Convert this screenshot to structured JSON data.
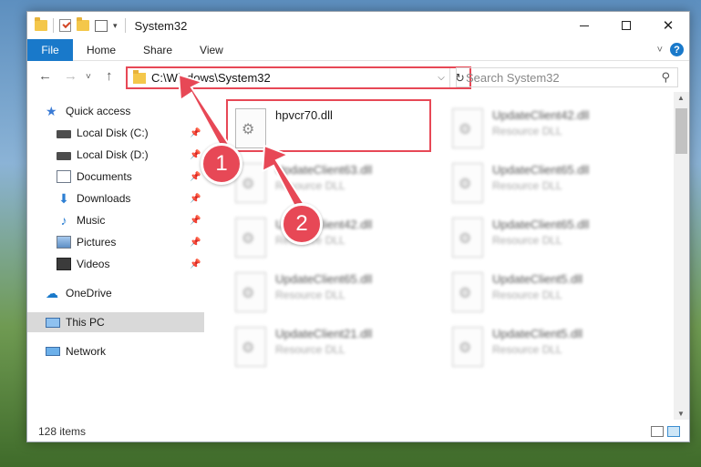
{
  "window": {
    "title": "System32",
    "buttons": {
      "minimize": "—",
      "maximize": "□",
      "close": "✕"
    }
  },
  "ribbon": {
    "file_tab": "File",
    "tabs": [
      "Home",
      "Share",
      "View"
    ]
  },
  "navbar": {
    "back": "←",
    "forward": "→",
    "recent": "˅",
    "up": "↑",
    "address": "C:\\Windows\\System32",
    "search_placeholder": "Search System32"
  },
  "sidebar": {
    "items": [
      {
        "label": "Quick access",
        "icon": "star-icon"
      },
      {
        "label": "Local Disk (C:)",
        "icon": "drive-icon",
        "pinned": true
      },
      {
        "label": "Local Disk (D:)",
        "icon": "drive-icon",
        "pinned": true
      },
      {
        "label": "Documents",
        "icon": "documents-icon",
        "pinned": true
      },
      {
        "label": "Downloads",
        "icon": "downloads-icon",
        "pinned": true
      },
      {
        "label": "Music",
        "icon": "music-icon",
        "pinned": true
      },
      {
        "label": "Pictures",
        "icon": "pictures-icon",
        "pinned": true
      },
      {
        "label": "Videos",
        "icon": "videos-icon",
        "pinned": true
      },
      {
        "label": "OneDrive",
        "icon": "onedrive-icon"
      },
      {
        "label": "This PC",
        "icon": "this-pc-icon",
        "selected": true
      },
      {
        "label": "Network",
        "icon": "network-icon"
      }
    ]
  },
  "files": [
    {
      "name": "hpvcr70.dll",
      "type": "",
      "highlighted": true
    },
    {
      "name": "UpdateClient42.dll",
      "type": "Resource DLL"
    },
    {
      "name": "UpdateClient63.dll",
      "type": "Resource DLL"
    },
    {
      "name": "UpdateClient65.dll",
      "type": "Resource DLL"
    },
    {
      "name": "UpdateClient42.dll",
      "type": "Resource DLL"
    },
    {
      "name": "UpdateClient65.dll",
      "type": "Resource DLL"
    },
    {
      "name": "UpdateClient65.dll",
      "type": "Resource DLL"
    },
    {
      "name": "UpdateClient5.dll",
      "type": "Resource DLL"
    },
    {
      "name": "UpdateClient21.dll",
      "type": "Resource DLL"
    },
    {
      "name": "UpdateClient5.dll",
      "type": "Resource DLL"
    }
  ],
  "statusbar": {
    "item_count": "128 items"
  },
  "annotations": {
    "step1": "1",
    "step2": "2"
  },
  "colors": {
    "accent": "#1979ca",
    "highlight": "#e74856"
  }
}
